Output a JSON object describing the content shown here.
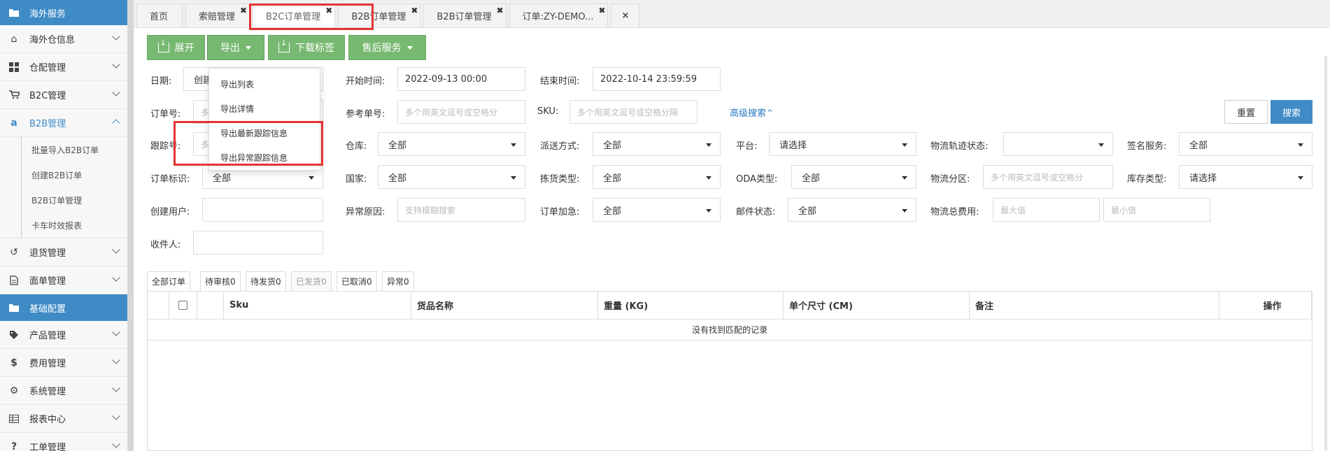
{
  "sidebar": {
    "sections": [
      {
        "label": "海外服务",
        "icon": "folder-icon"
      },
      {
        "label": "基础配置",
        "icon": "folder-icon"
      }
    ],
    "items_top": [
      {
        "label": "海外仓信息",
        "icon": "home-icon"
      },
      {
        "label": "仓配管理",
        "icon": "grid-icon"
      },
      {
        "label": "B2C管理",
        "icon": "cart-icon"
      },
      {
        "label": "B2B管理",
        "icon": "amazon-icon"
      }
    ],
    "sub_items": [
      "批量导入B2B订单",
      "创建B2B订单",
      "B2B订单管理",
      "卡车时效报表"
    ],
    "items_mid": [
      {
        "label": "退货管理",
        "icon": "undo-icon"
      },
      {
        "label": "面单管理",
        "icon": "document-icon"
      }
    ],
    "items_bottom": [
      {
        "label": "产品管理",
        "icon": "tag-icon"
      },
      {
        "label": "费用管理",
        "icon": "dollar-icon"
      },
      {
        "label": "系统管理",
        "icon": "gear-icon"
      },
      {
        "label": "报表中心",
        "icon": "table-icon"
      },
      {
        "label": "工单管理",
        "icon": "question-icon"
      }
    ]
  },
  "tabs": [
    {
      "label": "首页",
      "closable": false
    },
    {
      "label": "索赔管理",
      "closable": true
    },
    {
      "label": "B2C订单管理",
      "closable": true
    },
    {
      "label": "B2B订单管理",
      "closable": true
    },
    {
      "label": "B2B订单管理",
      "closable": true
    },
    {
      "label": "订单:ZY-DEMO...",
      "closable": true
    }
  ],
  "close_all": "×",
  "toolbar": {
    "expand": "展开",
    "export": "导出",
    "download_label": "下载标签",
    "after_sales": "售后服务"
  },
  "export_menu": [
    "导出列表",
    "导出详情",
    "导出最新跟踪信息",
    "导出异常跟踪信息"
  ],
  "filters": {
    "date_label": "日期:",
    "date_value": "创建",
    "start_label": "开始时间:",
    "start_value": "2022-09-13 00:00",
    "end_label": "结束时间:",
    "end_value": "2022-10-14 23:59:59",
    "order_no_label": "订单号:",
    "order_no_placeholder": "多",
    "ref_no_label": "参考单号:",
    "ref_no_placeholder": "多个用英文逗号或空格分",
    "sku_label": "SKU:",
    "sku_placeholder": "多个用英文逗号或空格分隔",
    "advanced": "高级搜索⌃",
    "reset": "重置",
    "search": "搜索",
    "tracking_label": "跟踪号:",
    "tracking_placeholder": "多",
    "warehouse_label": "仓库:",
    "warehouse_value": "全部",
    "delivery_label": "派送方式:",
    "delivery_value": "全部",
    "platform_label": "平台:",
    "platform_value": "请选择",
    "track_status_label": "物流轨迹状态:",
    "track_status_value": "",
    "signature_label": "签名服务:",
    "signature_value": "全部",
    "order_flag_label": "订单标识:",
    "order_flag_value": "全部",
    "country_label": "国家:",
    "country_value": "全部",
    "pick_type_label": "拣货类型:",
    "pick_type_value": "全部",
    "oda_label": "ODA类型:",
    "oda_value": "全部",
    "zone_label": "物流分区:",
    "zone_placeholder": "多个用英文逗号或空格分",
    "stock_type_label": "库存类型:",
    "stock_type_value": "请选择",
    "creator_label": "创建用户:",
    "creator_value": "",
    "exception_label": "异常原因:",
    "exception_placeholder": "支持模糊搜索",
    "urgent_label": "订单加急:",
    "urgent_value": "全部",
    "mail_label": "邮件状态:",
    "mail_value": "全部",
    "total_fee_label": "物流总费用:",
    "max_placeholder": "最大值",
    "min_placeholder": "最小值",
    "recipient_label": "收件人:",
    "recipient_value": ""
  },
  "status_tabs": [
    "全部订单",
    "待审核0",
    "待发货0",
    "已发货0",
    "已取消0",
    "异常0"
  ],
  "table": {
    "columns": [
      "",
      "",
      "Sku",
      "货品名称",
      "重量 (KG)",
      "单个尺寸 (CM)",
      "备注",
      "操作"
    ],
    "empty_text": "没有找到匹配的记录"
  },
  "colors": {
    "sidebar_section": "#3f8bc6",
    "green_button": "#78b971",
    "primary": "#3f8bc6",
    "highlight": "#e53333"
  }
}
